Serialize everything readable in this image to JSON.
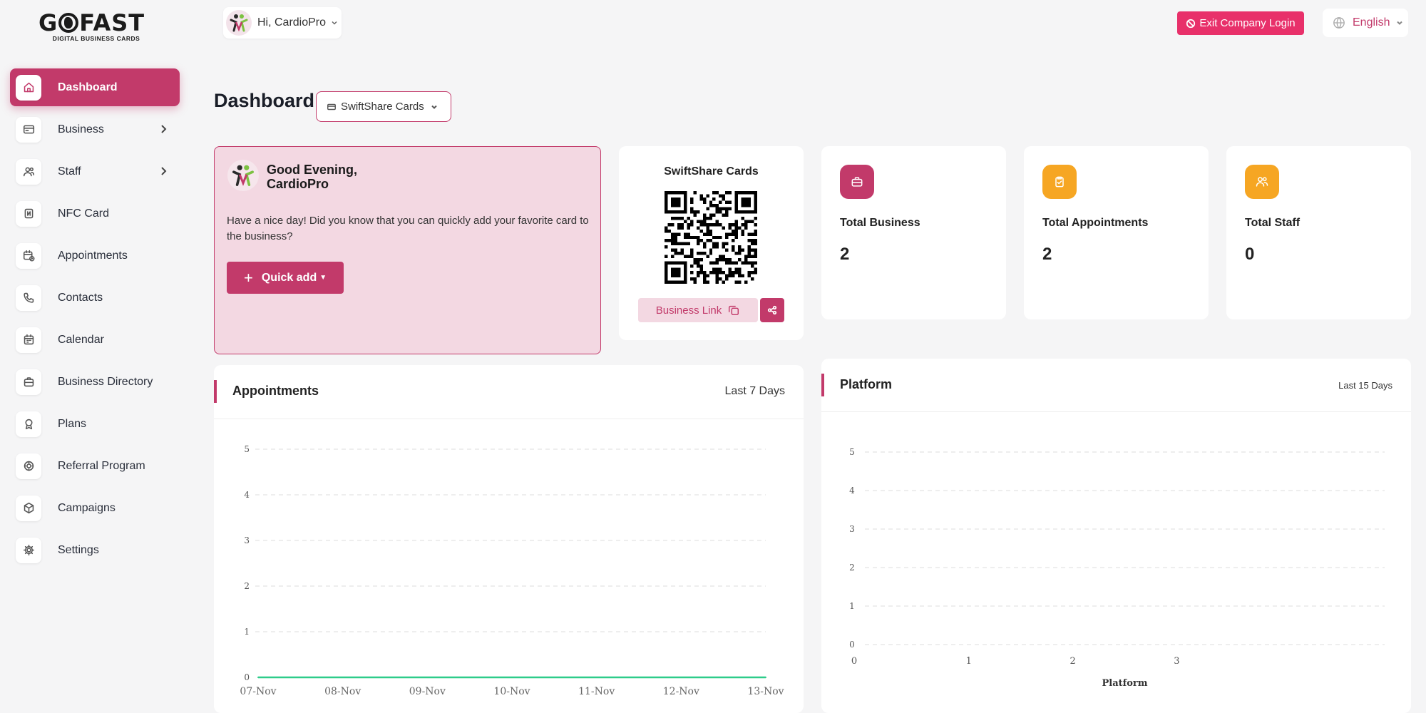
{
  "brand": {
    "name": "GOFAST",
    "tagline": "DIGITAL BUSINESS CARDS"
  },
  "header": {
    "greeting": "Hi, CardioPro",
    "exit_label": "Exit Company Login",
    "language": "English"
  },
  "sidebar": {
    "items": [
      {
        "label": "Dashboard",
        "icon": "home-icon",
        "active": true
      },
      {
        "label": "Business",
        "icon": "card-icon",
        "submenu": true
      },
      {
        "label": "Staff",
        "icon": "users-icon",
        "submenu": true
      },
      {
        "label": "NFC Card",
        "icon": "nfc-icon"
      },
      {
        "label": "Appointments",
        "icon": "calendar-clock-icon"
      },
      {
        "label": "Contacts",
        "icon": "phone-icon"
      },
      {
        "label": "Calendar",
        "icon": "calendar-icon"
      },
      {
        "label": "Business Directory",
        "icon": "briefcase-icon"
      },
      {
        "label": "Plans",
        "icon": "award-icon"
      },
      {
        "label": "Referral Program",
        "icon": "referral-icon"
      },
      {
        "label": "Campaigns",
        "icon": "box-icon"
      },
      {
        "label": "Settings",
        "icon": "gear-icon"
      }
    ]
  },
  "main": {
    "title": "Dashboard",
    "card_select": "SwiftShare Cards",
    "welcome": {
      "greeting_line1": "Good Evening,",
      "greeting_line2": "CardioPro",
      "message": "Have a nice day! Did you know that you can quickly add your favorite card to the business?",
      "quick_add": "Quick add"
    },
    "qr_card": {
      "title": "SwiftShare Cards",
      "link_label": "Business Link"
    },
    "stats": [
      {
        "label": "Total Business",
        "value": "2",
        "color": "#c23a6a",
        "icon": "briefcase-icon"
      },
      {
        "label": "Total Appointments",
        "value": "2",
        "color": "#f6a623",
        "icon": "clipboard-check-icon"
      },
      {
        "label": "Total Staff",
        "value": "0",
        "color": "#f6a623",
        "icon": "users-icon"
      }
    ],
    "appointments_panel": {
      "title": "Appointments",
      "range": "Last 7 Days"
    },
    "platform_panel": {
      "title": "Platform",
      "range": "Last 15 Days"
    }
  },
  "chart_data": [
    {
      "type": "line",
      "categories": [
        "07-Nov",
        "08-Nov",
        "09-Nov",
        "10-Nov",
        "11-Nov",
        "12-Nov",
        "13-Nov"
      ],
      "series": [
        {
          "values": [
            0,
            0,
            0,
            0,
            0,
            0,
            0
          ],
          "color": "#2ecc8a"
        }
      ],
      "yticks": [
        "0",
        "1",
        "2",
        "3",
        "4",
        "5"
      ],
      "ylim": [
        0,
        5
      ],
      "grid": true
    },
    {
      "type": "bar",
      "xlabel": "Platform",
      "xticks": [
        "0",
        "1",
        "2",
        "3"
      ],
      "yticks": [
        "0",
        "1",
        "2",
        "3",
        "4",
        "5"
      ],
      "xlim": [
        0,
        5
      ],
      "ylim": [
        0,
        5
      ],
      "grid": true
    }
  ]
}
